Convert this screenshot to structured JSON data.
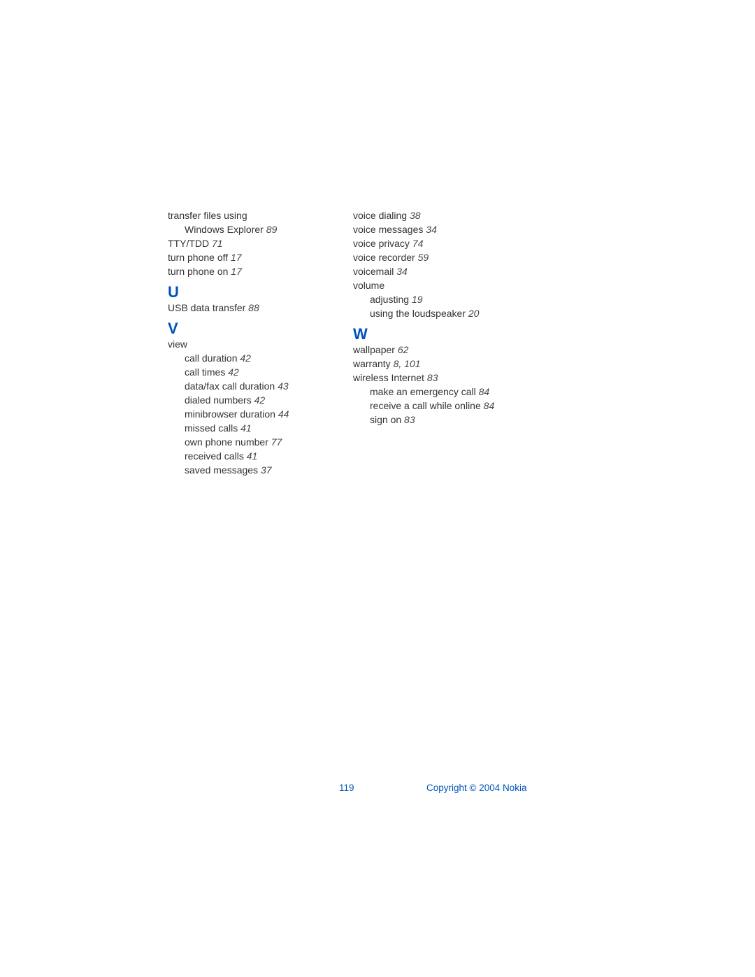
{
  "left_column": {
    "pre_entries": [
      {
        "text": "transfer files using",
        "pages": "",
        "indent": 0
      },
      {
        "text": "Windows Explorer",
        "pages": "89",
        "indent": 1
      },
      {
        "text": "TTY/TDD",
        "pages": "71",
        "indent": 0
      },
      {
        "text": "turn phone off",
        "pages": "17",
        "indent": 0
      },
      {
        "text": "turn phone on",
        "pages": "17",
        "indent": 0
      }
    ],
    "letter_u": "U",
    "u_entries": [
      {
        "text": "USB data transfer",
        "pages": "88",
        "indent": 0
      }
    ],
    "letter_v": "V",
    "v_entries": [
      {
        "text": "view",
        "pages": "",
        "indent": 0
      },
      {
        "text": "call duration",
        "pages": "42",
        "indent": 1
      },
      {
        "text": "call times",
        "pages": "42",
        "indent": 1
      },
      {
        "text": "data/fax call duration",
        "pages": "43",
        "indent": 1
      },
      {
        "text": "dialed numbers",
        "pages": "42",
        "indent": 1
      },
      {
        "text": "minibrowser duration",
        "pages": "44",
        "indent": 1
      },
      {
        "text": "missed calls",
        "pages": "41",
        "indent": 1
      },
      {
        "text": "own phone number",
        "pages": "77",
        "indent": 1
      },
      {
        "text": "received calls",
        "pages": "41",
        "indent": 1
      },
      {
        "text": "saved messages",
        "pages": "37",
        "indent": 1
      }
    ]
  },
  "right_column": {
    "pre_entries": [
      {
        "text": "voice dialing",
        "pages": "38",
        "indent": 0
      },
      {
        "text": "voice messages",
        "pages": "34",
        "indent": 0
      },
      {
        "text": "voice privacy",
        "pages": "74",
        "indent": 0
      },
      {
        "text": "voice recorder",
        "pages": "59",
        "indent": 0
      },
      {
        "text": "voicemail",
        "pages": "34",
        "indent": 0
      },
      {
        "text": "volume",
        "pages": "",
        "indent": 0
      },
      {
        "text": "adjusting",
        "pages": "19",
        "indent": 1
      },
      {
        "text": "using the loudspeaker",
        "pages": "20",
        "indent": 1
      }
    ],
    "letter_w": "W",
    "w_entries": [
      {
        "text": "wallpaper",
        "pages": "62",
        "indent": 0
      },
      {
        "text": "warranty",
        "pages": "8, 101",
        "indent": 0
      },
      {
        "text": "wireless Internet",
        "pages": "83",
        "indent": 0
      },
      {
        "text": "make an emergency call",
        "pages": "84",
        "indent": 1
      },
      {
        "text": "receive a call while online",
        "pages": "84",
        "indent": 1
      },
      {
        "text": "sign on",
        "pages": "83",
        "indent": 1
      }
    ]
  },
  "footer": {
    "page_number": "119",
    "copyright": "Copyright © 2004 Nokia"
  }
}
